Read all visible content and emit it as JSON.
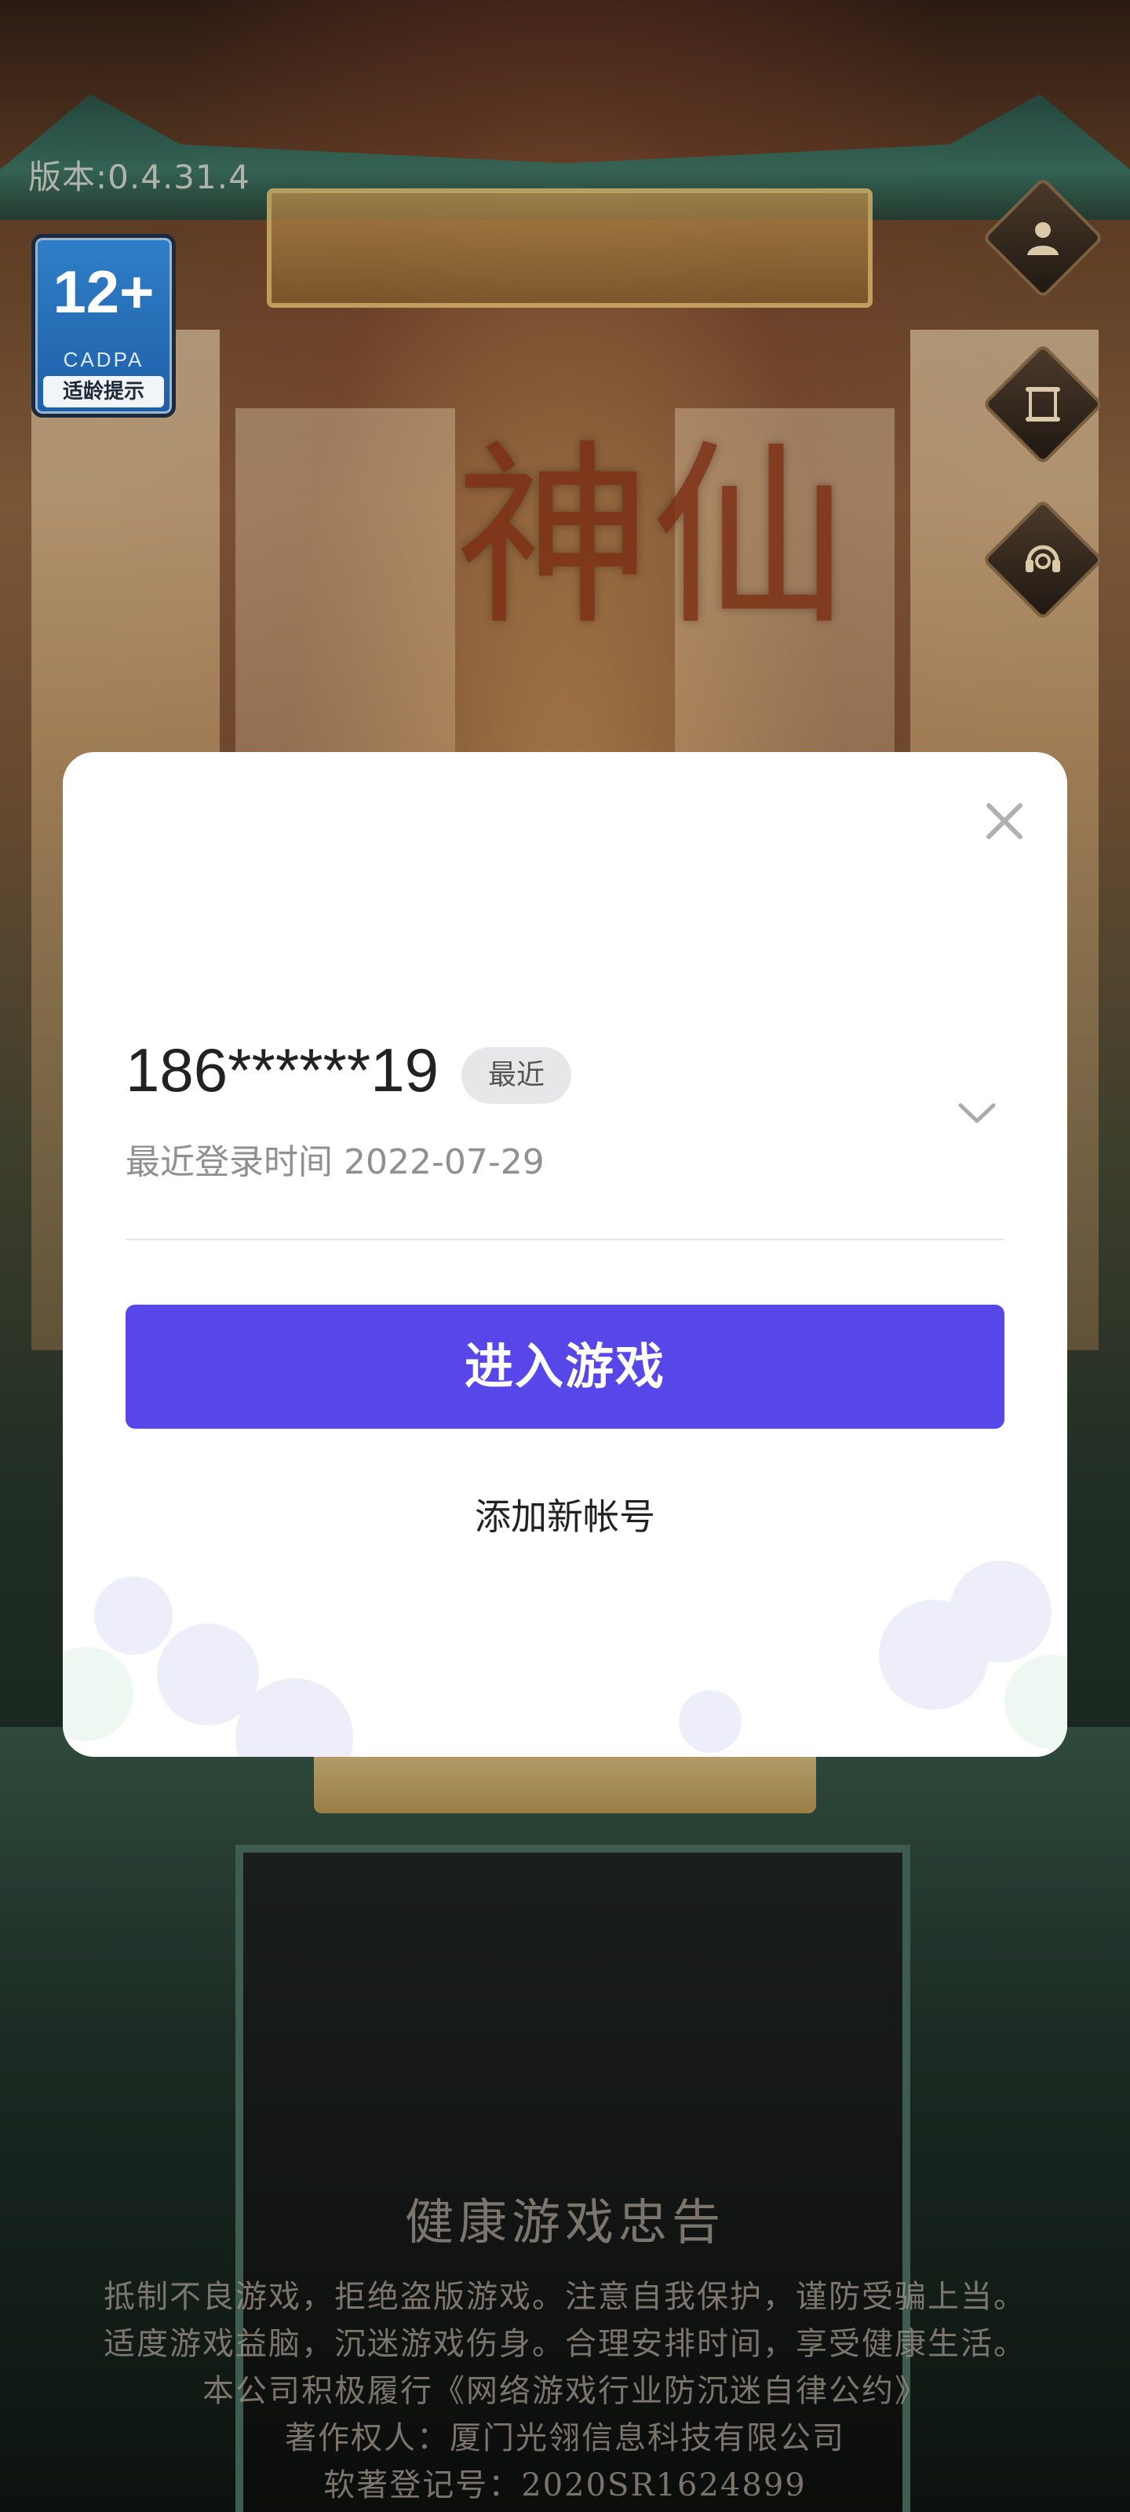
{
  "hud": {
    "version": "版本:0.4.31.4",
    "age_rating": {
      "number": "12+",
      "org": "CADPA",
      "label": "适龄提示"
    }
  },
  "side_buttons": [
    {
      "icon": "user-icon"
    },
    {
      "icon": "scroll-icon"
    },
    {
      "icon": "headset-icon"
    }
  ],
  "login_dialog": {
    "account": "186******19",
    "recent_tag": "最近",
    "last_login": "最近登录时间 2022-07-29",
    "enter_button": "进入游戏",
    "add_account": "添加新帐号"
  },
  "health_notice": {
    "title": "健康游戏忠告",
    "lines": [
      "抵制不良游戏，拒绝盗版游戏。注意自我保护，谨防受骗上当。",
      "适度游戏益脑，沉迷游戏伤身。合理安排时间，享受健康生活。",
      "本公司积极履行《网络游戏行业防沉迷自律公约》",
      "著作权人：厦门光翎信息科技有限公司",
      "软著登记号：2020SR1624899"
    ]
  },
  "colors": {
    "primary": "#5847e8",
    "dialog_bg": "#ffffff"
  }
}
